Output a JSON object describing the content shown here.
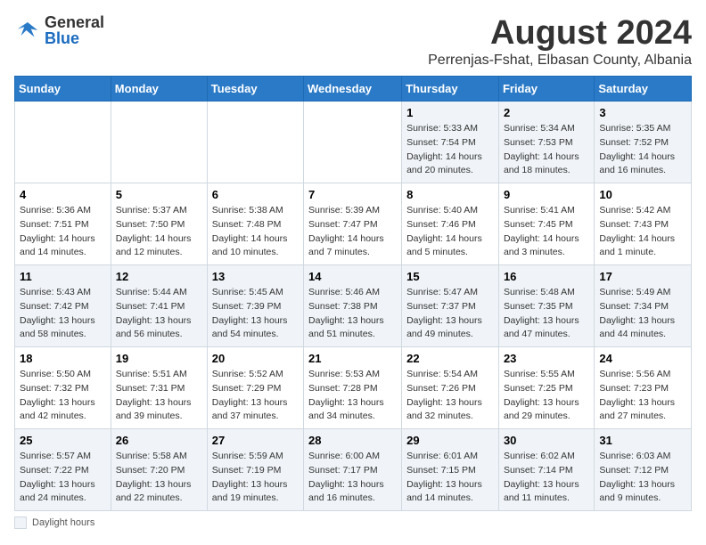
{
  "header": {
    "logo_general": "General",
    "logo_blue": "Blue",
    "month_title": "August 2024",
    "subtitle": "Perrenjas-Fshat, Elbasan County, Albania"
  },
  "days_of_week": [
    "Sunday",
    "Monday",
    "Tuesday",
    "Wednesday",
    "Thursday",
    "Friday",
    "Saturday"
  ],
  "footer": {
    "daylight_label": "Daylight hours"
  },
  "weeks": [
    [
      {
        "day": "",
        "detail": ""
      },
      {
        "day": "",
        "detail": ""
      },
      {
        "day": "",
        "detail": ""
      },
      {
        "day": "",
        "detail": ""
      },
      {
        "day": "1",
        "detail": "Sunrise: 5:33 AM\nSunset: 7:54 PM\nDaylight: 14 hours and 20 minutes."
      },
      {
        "day": "2",
        "detail": "Sunrise: 5:34 AM\nSunset: 7:53 PM\nDaylight: 14 hours and 18 minutes."
      },
      {
        "day": "3",
        "detail": "Sunrise: 5:35 AM\nSunset: 7:52 PM\nDaylight: 14 hours and 16 minutes."
      }
    ],
    [
      {
        "day": "4",
        "detail": "Sunrise: 5:36 AM\nSunset: 7:51 PM\nDaylight: 14 hours and 14 minutes."
      },
      {
        "day": "5",
        "detail": "Sunrise: 5:37 AM\nSunset: 7:50 PM\nDaylight: 14 hours and 12 minutes."
      },
      {
        "day": "6",
        "detail": "Sunrise: 5:38 AM\nSunset: 7:48 PM\nDaylight: 14 hours and 10 minutes."
      },
      {
        "day": "7",
        "detail": "Sunrise: 5:39 AM\nSunset: 7:47 PM\nDaylight: 14 hours and 7 minutes."
      },
      {
        "day": "8",
        "detail": "Sunrise: 5:40 AM\nSunset: 7:46 PM\nDaylight: 14 hours and 5 minutes."
      },
      {
        "day": "9",
        "detail": "Sunrise: 5:41 AM\nSunset: 7:45 PM\nDaylight: 14 hours and 3 minutes."
      },
      {
        "day": "10",
        "detail": "Sunrise: 5:42 AM\nSunset: 7:43 PM\nDaylight: 14 hours and 1 minute."
      }
    ],
    [
      {
        "day": "11",
        "detail": "Sunrise: 5:43 AM\nSunset: 7:42 PM\nDaylight: 13 hours and 58 minutes."
      },
      {
        "day": "12",
        "detail": "Sunrise: 5:44 AM\nSunset: 7:41 PM\nDaylight: 13 hours and 56 minutes."
      },
      {
        "day": "13",
        "detail": "Sunrise: 5:45 AM\nSunset: 7:39 PM\nDaylight: 13 hours and 54 minutes."
      },
      {
        "day": "14",
        "detail": "Sunrise: 5:46 AM\nSunset: 7:38 PM\nDaylight: 13 hours and 51 minutes."
      },
      {
        "day": "15",
        "detail": "Sunrise: 5:47 AM\nSunset: 7:37 PM\nDaylight: 13 hours and 49 minutes."
      },
      {
        "day": "16",
        "detail": "Sunrise: 5:48 AM\nSunset: 7:35 PM\nDaylight: 13 hours and 47 minutes."
      },
      {
        "day": "17",
        "detail": "Sunrise: 5:49 AM\nSunset: 7:34 PM\nDaylight: 13 hours and 44 minutes."
      }
    ],
    [
      {
        "day": "18",
        "detail": "Sunrise: 5:50 AM\nSunset: 7:32 PM\nDaylight: 13 hours and 42 minutes."
      },
      {
        "day": "19",
        "detail": "Sunrise: 5:51 AM\nSunset: 7:31 PM\nDaylight: 13 hours and 39 minutes."
      },
      {
        "day": "20",
        "detail": "Sunrise: 5:52 AM\nSunset: 7:29 PM\nDaylight: 13 hours and 37 minutes."
      },
      {
        "day": "21",
        "detail": "Sunrise: 5:53 AM\nSunset: 7:28 PM\nDaylight: 13 hours and 34 minutes."
      },
      {
        "day": "22",
        "detail": "Sunrise: 5:54 AM\nSunset: 7:26 PM\nDaylight: 13 hours and 32 minutes."
      },
      {
        "day": "23",
        "detail": "Sunrise: 5:55 AM\nSunset: 7:25 PM\nDaylight: 13 hours and 29 minutes."
      },
      {
        "day": "24",
        "detail": "Sunrise: 5:56 AM\nSunset: 7:23 PM\nDaylight: 13 hours and 27 minutes."
      }
    ],
    [
      {
        "day": "25",
        "detail": "Sunrise: 5:57 AM\nSunset: 7:22 PM\nDaylight: 13 hours and 24 minutes."
      },
      {
        "day": "26",
        "detail": "Sunrise: 5:58 AM\nSunset: 7:20 PM\nDaylight: 13 hours and 22 minutes."
      },
      {
        "day": "27",
        "detail": "Sunrise: 5:59 AM\nSunset: 7:19 PM\nDaylight: 13 hours and 19 minutes."
      },
      {
        "day": "28",
        "detail": "Sunrise: 6:00 AM\nSunset: 7:17 PM\nDaylight: 13 hours and 16 minutes."
      },
      {
        "day": "29",
        "detail": "Sunrise: 6:01 AM\nSunset: 7:15 PM\nDaylight: 13 hours and 14 minutes."
      },
      {
        "day": "30",
        "detail": "Sunrise: 6:02 AM\nSunset: 7:14 PM\nDaylight: 13 hours and 11 minutes."
      },
      {
        "day": "31",
        "detail": "Sunrise: 6:03 AM\nSunset: 7:12 PM\nDaylight: 13 hours and 9 minutes."
      }
    ]
  ]
}
